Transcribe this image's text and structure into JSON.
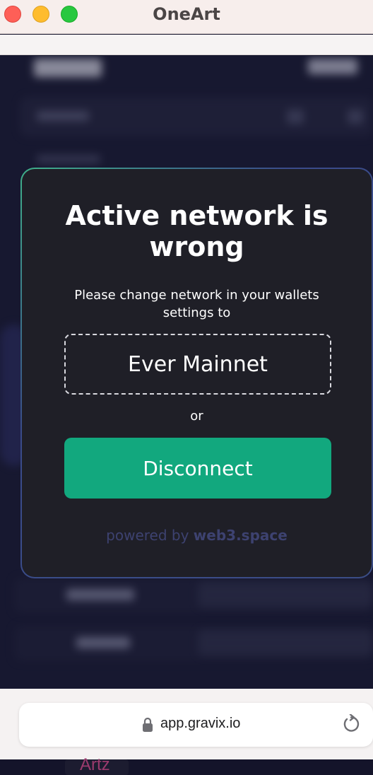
{
  "window": {
    "title": "OneArt"
  },
  "modal": {
    "title": "Active network is wrong",
    "subtitle": "Please change network in your wallets settings to",
    "network_name": "Ever Mainnet",
    "or_label": "or",
    "disconnect_label": "Disconnect",
    "powered_prefix": "powered by",
    "powered_brand": "web3.space"
  },
  "browser": {
    "url": "app.gravix.io"
  },
  "background": {
    "bottom_label": "Artz"
  },
  "colors": {
    "accent": "#12a87e",
    "modal_bg": "#1f1f27",
    "powered_text": "#3d4270"
  }
}
